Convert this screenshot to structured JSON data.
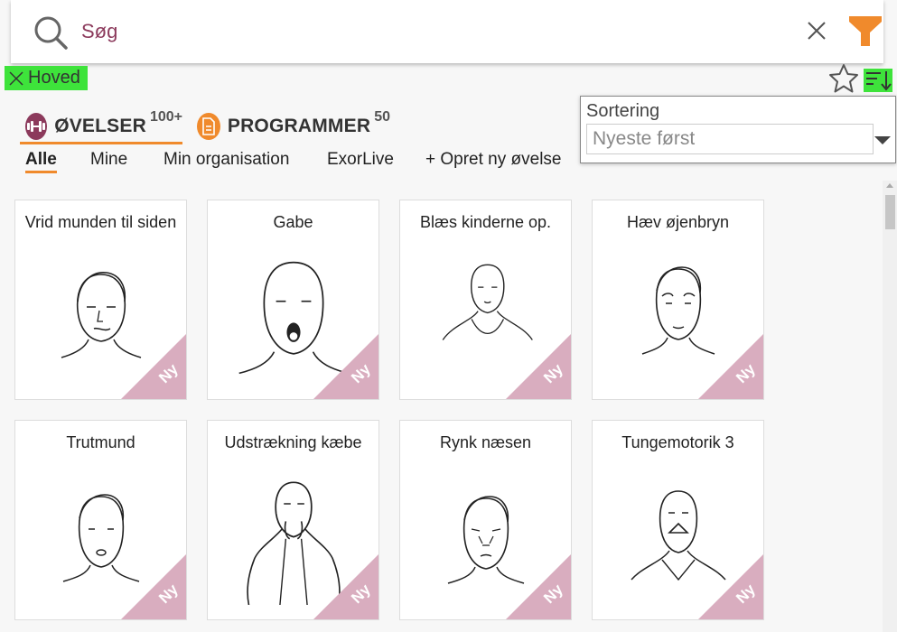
{
  "search": {
    "placeholder": "Søg",
    "value": "Søg"
  },
  "filter_chip": {
    "label": "Hoved"
  },
  "sort_panel": {
    "label": "Sortering",
    "selected": "Nyeste først"
  },
  "main_tabs": [
    {
      "label": "ØVELSER",
      "count": "100+",
      "color": "#8c3a5c"
    },
    {
      "label": "PROGRAMMER",
      "count": "50",
      "color": "#f08a2c"
    }
  ],
  "sub_tabs": [
    {
      "label": "Alle"
    },
    {
      "label": "Mine"
    },
    {
      "label": "Min organisation"
    },
    {
      "label": "ExorLive"
    },
    {
      "label": "+ Opret ny øvelse"
    }
  ],
  "cards": [
    {
      "title": "Vrid munden til siden",
      "badge": "Ny"
    },
    {
      "title": "Gabe",
      "badge": "Ny"
    },
    {
      "title": "Blæs kinderne op.",
      "badge": "Ny"
    },
    {
      "title": "Hæv øjenbryn",
      "badge": "Ny"
    },
    {
      "title": "Trutmund",
      "badge": "Ny"
    },
    {
      "title": "Udstrækning kæbe",
      "badge": "Ny"
    },
    {
      "title": "Rynk næsen",
      "badge": "Ny"
    },
    {
      "title": "Tungemotorik 3",
      "badge": "Ny"
    }
  ],
  "colors": {
    "accent": "#f08a2c",
    "brand": "#8c3a5c",
    "highlight": "#3ee33b",
    "ribbon": "#d9adbf"
  }
}
